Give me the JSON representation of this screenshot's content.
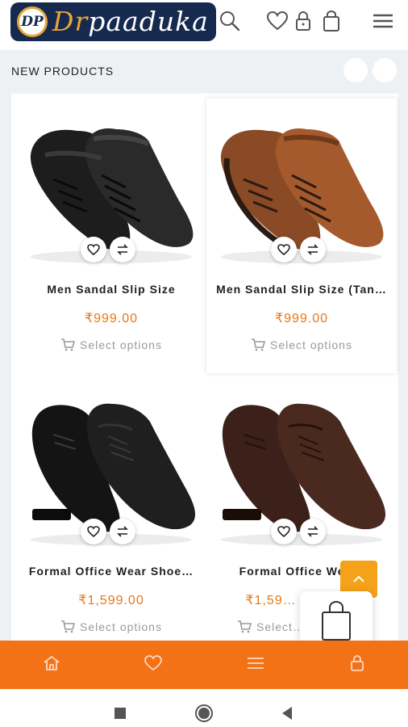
{
  "header": {
    "logo_badge": "DP",
    "logo_prefix": "Dr",
    "logo_name": "paaduka",
    "icons": [
      "search-icon",
      "heart-icon",
      "lock-icon",
      "bag-icon",
      "menu-icon"
    ]
  },
  "section": {
    "title": "NEW PRODUCTS"
  },
  "products": [
    {
      "name": "Men Sandal Slip Size",
      "price": "₹999.00",
      "action": "Select options",
      "color": "black",
      "style": "sandal"
    },
    {
      "name": "Men Sandal Slip Size (Tan…",
      "price": "₹999.00",
      "action": "Select options",
      "color": "tan",
      "style": "sandal"
    },
    {
      "name": "Formal Office Wear Shoe…",
      "price": "₹1,599.00",
      "action": "Select options",
      "color": "black",
      "style": "formal"
    },
    {
      "name": "Formal Office Wea…",
      "price": "₹1,59…",
      "action": "Select…",
      "color": "brown",
      "style": "formal"
    }
  ],
  "bottom_nav": {
    "icons": [
      "home-icon",
      "heart-icon",
      "menu-icon",
      "lock-icon"
    ]
  },
  "system_nav": {
    "icons": [
      "recents-icon",
      "home-circle-icon",
      "back-icon"
    ]
  },
  "colors": {
    "accent": "#f47216",
    "price": "#e67817",
    "navy": "#16294f",
    "gold": "#e7a538"
  }
}
